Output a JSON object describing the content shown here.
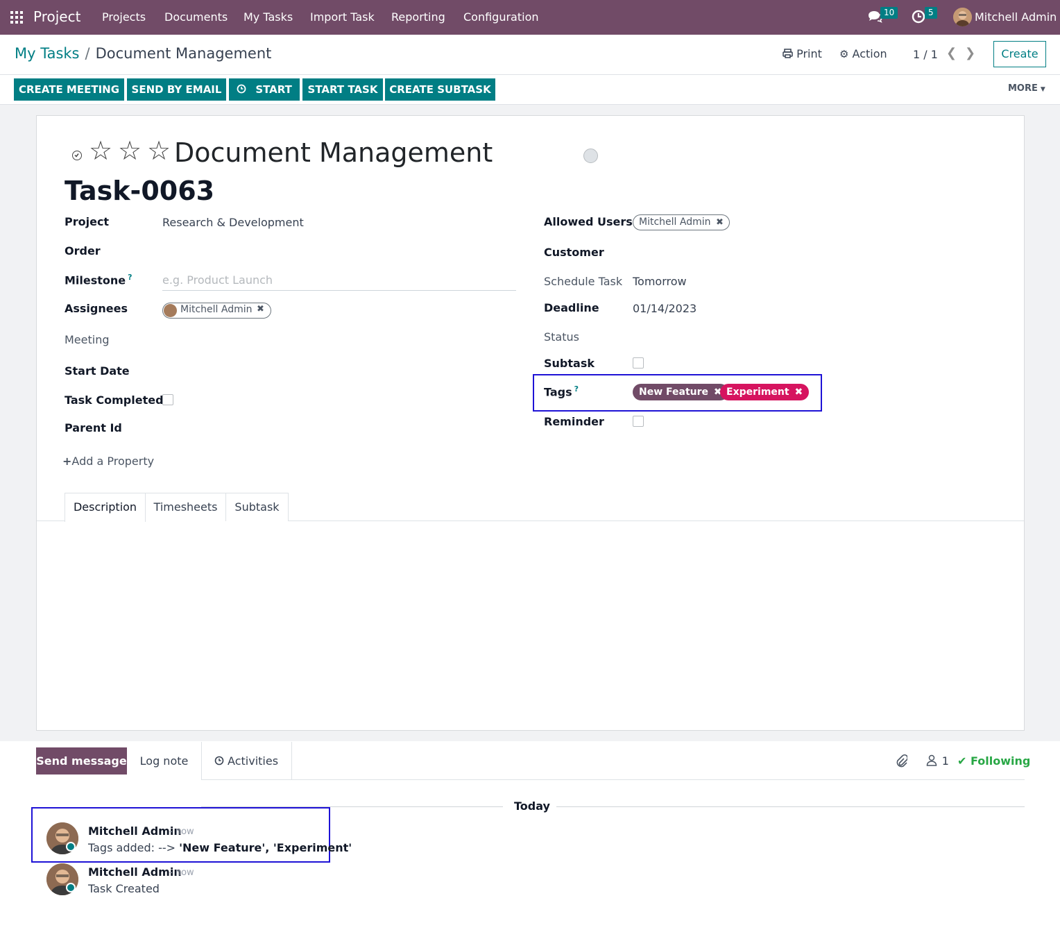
{
  "navbar": {
    "app_name": "Project",
    "menu": [
      "Projects",
      "Documents",
      "My Tasks",
      "Import Task",
      "Reporting",
      "Configuration"
    ],
    "messages_count": "10",
    "activities_count": "5",
    "user": "Mitchell Admin",
    "brand_color": "#714b67"
  },
  "breadcrumb": {
    "parent": "My Tasks",
    "separator": "/",
    "current": "Document Management"
  },
  "control": {
    "print": "Print",
    "action": "Action",
    "pager": "1 / 1",
    "create": "Create"
  },
  "actions": {
    "create_meeting": "CREATE MEETING",
    "send_by_email": "SEND BY EMAIL",
    "start": "START",
    "start_task": "START TASK",
    "create_subtask": "CREATE SUBTASK",
    "more": "MORE"
  },
  "task": {
    "name": "Document Management",
    "number": "Task-0063",
    "priority_stars": 3
  },
  "left_fields": {
    "project_label": "Project",
    "project_value": "Research & Development",
    "order_label": "Order",
    "milestone_label": "Milestone",
    "milestone_help": "?",
    "milestone_placeholder": "e.g. Product Launch",
    "assignees_label": "Assignees",
    "assignee": "Mitchell Admin",
    "meeting_label": "Meeting",
    "start_date_label": "Start Date",
    "task_completed_label": "Task Completed",
    "parent_id_label": "Parent Id",
    "add_property": "Add a Property"
  },
  "right_fields": {
    "allowed_users_label": "Allowed Users",
    "allowed_user": "Mitchell Admin",
    "customer_label": "Customer",
    "schedule_label": "Schedule Task",
    "schedule_value": "Tomorrow",
    "deadline_label": "Deadline",
    "deadline_value": "01/14/2023",
    "status_label": "Status",
    "subtask_label": "Subtask",
    "tags_label": "Tags",
    "tags_help": "?",
    "tags": [
      {
        "name": "New Feature",
        "color": "#714b67"
      },
      {
        "name": "Experiment",
        "color": "#d6145f"
      }
    ],
    "reminder_label": "Reminder"
  },
  "tabs": [
    "Description",
    "Timesheets",
    "Subtask"
  ],
  "chatter": {
    "send_message": "Send message",
    "log_note": "Log note",
    "activities": "Activities",
    "followers_count": "1",
    "following": "Following",
    "today": "Today",
    "messages": [
      {
        "author": "Mitchell Admin",
        "time": "- now",
        "body_prefix": "Tags added: --> ",
        "body_strong": "'New Feature', 'Experiment'"
      },
      {
        "author": "Mitchell Admin",
        "time": "- now",
        "body_prefix": "Task Created",
        "body_strong": ""
      }
    ]
  }
}
